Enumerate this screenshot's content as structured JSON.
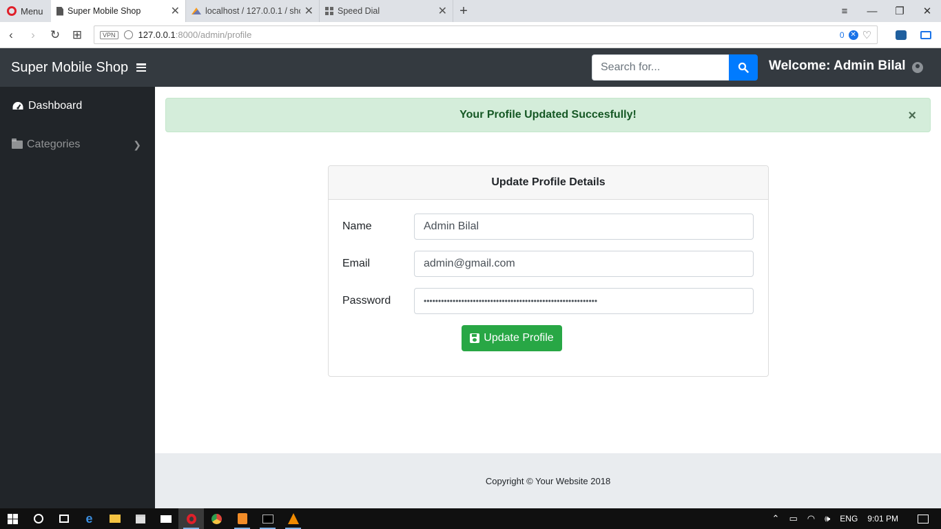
{
  "browser": {
    "menu_label": "Menu",
    "tabs": [
      {
        "title": "Super Mobile Shop",
        "icon": "page-icon",
        "active": true
      },
      {
        "title": "localhost / 127.0.0.1 / sho",
        "icon": "phpmyadmin-icon",
        "active": false
      },
      {
        "title": "Speed Dial",
        "icon": "speed-dial-icon",
        "active": false
      }
    ],
    "new_tab_label": "+",
    "address": {
      "vpn_label": "VPN",
      "host": "127.0.0.1",
      "path": ":8000/admin/profile",
      "blocked_count": "0"
    }
  },
  "app": {
    "brand": "Super Mobile Shop",
    "search": {
      "placeholder": "Search for..."
    },
    "welcome": "Welcome: Admin Bilal",
    "sidebar": {
      "items": [
        {
          "label": "Dashboard",
          "icon": "tachometer-icon",
          "active": true
        },
        {
          "label": "Categories",
          "icon": "folder-icon",
          "active": false
        }
      ]
    },
    "alert": {
      "message": "Your Profile Updated Succesfully!",
      "close": "×"
    },
    "card": {
      "title": "Update Profile Details",
      "fields": {
        "name_label": "Name",
        "name_value": "Admin Bilal",
        "email_label": "Email",
        "email_value": "admin@gmail.com",
        "password_label": "Password",
        "password_value": "••••••••••••••••••••••••••••••••••••••••••••••••••••••••••••"
      },
      "submit_label": "Update Profile"
    },
    "footer": "Copyright © Your Website 2018"
  },
  "taskbar": {
    "tray": {
      "language": "ENG",
      "time": "9:01 PM"
    }
  },
  "colors": {
    "navbar": "#343a40",
    "sidebar": "#212529",
    "primary": "#007bff",
    "success": "#28a745",
    "alert_bg": "#d4edda",
    "alert_text": "#155724"
  }
}
